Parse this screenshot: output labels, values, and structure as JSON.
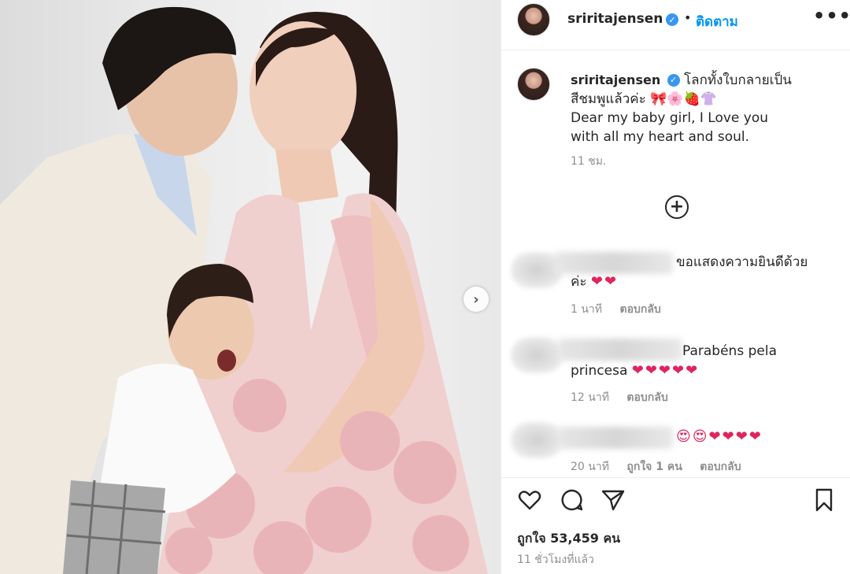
{
  "header": {
    "username": "sriritajensen",
    "separator": "•",
    "follow_label": "ติดตาม",
    "more_label": "•••"
  },
  "caption": {
    "username": "sriritajensen",
    "text_line1": "โลกทั้งใบกลายเป็น",
    "text_line2": "สีชมพูแล้วค่ะ",
    "text_emoji": "🎀🌸🍓👚",
    "text_line3": "Dear my baby girl, I Love you",
    "text_line4": "with all my heart and soul.",
    "time": "11 ชม."
  },
  "load_more_label": "+",
  "comments": [
    {
      "text_line1": "ขอแสดงความยินดีด้วย",
      "text_line2": "ค่ะ",
      "emoji": "❤❤",
      "time": "1 นาที",
      "likes": "",
      "reply": "ตอบกลับ"
    },
    {
      "text_line1": "Parabéns pela",
      "text_line2": "princesa",
      "emoji": "❤❤❤❤❤",
      "time": "12 นาที",
      "likes": "",
      "reply": "ตอบกลับ"
    },
    {
      "text_line1": "",
      "text_line2": "",
      "emoji": "😍😍❤❤❤❤",
      "time": "20 นาที",
      "likes": "ถูกใจ 1 คน",
      "reply": "ตอบกลับ"
    }
  ],
  "likes_text": "ถูกใจ 53,459 คน",
  "posted_time": "11 ชั่วโมงที่แล้ว",
  "icons": {
    "like": "heart-outline-icon",
    "comment": "comment-bubble-icon",
    "share": "paper-plane-icon",
    "save": "bookmark-icon"
  },
  "colors": {
    "accent": "#0095f6",
    "verified": "#3897f0",
    "heart": "#e0245e",
    "muted": "#8e8e8e"
  }
}
